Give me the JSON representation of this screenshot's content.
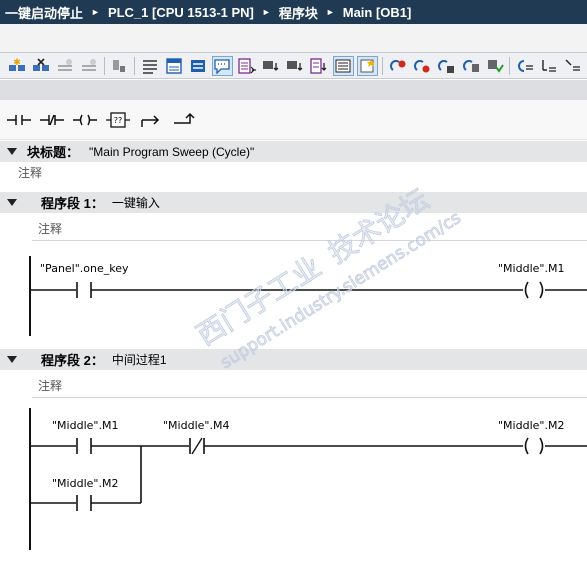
{
  "breadcrumb": {
    "project": "一键启动停止",
    "device": "PLC_1 [CPU 1513-1 PN]",
    "folder": "程序块",
    "block": "Main [OB1]"
  },
  "toolbar": {
    "icons": [
      "insert-network-icon",
      "delete-network-icon",
      "insert-row-icon",
      "add-row-icon",
      "display-icon",
      "absolute-operands-icon",
      "network-overview-icon",
      "symbol-info-icon",
      "comments-icon",
      "favorites-icon",
      "address-info-icon",
      "symbolic-icon",
      "monitor-icon",
      "list-icon",
      "insert-favorites-icon",
      "call-block-icon",
      "delete-call-icon",
      "update-call-icon",
      "compare-icon",
      "download-icon",
      "monitor-start-icon",
      "indent-icon",
      "expand-icon"
    ]
  },
  "ladder_toolbar": {
    "items": [
      "no-contact",
      "nc-contact",
      "coil",
      "empty-box",
      "open-branch",
      "close-branch"
    ]
  },
  "block": {
    "title_label": "块标题：",
    "title_value": "\"Main Program Sweep (Cycle)\"",
    "comment": "注释"
  },
  "networks": [
    {
      "label": "程序段 1：",
      "title": "一键输入",
      "comment": "注释",
      "contact_tag": "\"Panel\".one_key",
      "coil_tag": "\"Middle\".M1"
    },
    {
      "label": "程序段 2：",
      "title": "中间过程1",
      "comment": "注释",
      "contact1_tag": "\"Middle\".M1",
      "contact2_tag": "\"Middle\".M4",
      "branch_tag": "\"Middle\".M2",
      "coil_tag": "\"Middle\".M2"
    }
  ],
  "watermark": {
    "line1": "西门子工业",
    "line2": "技术论坛",
    "url": "support.industry.siemens.com/cs"
  }
}
